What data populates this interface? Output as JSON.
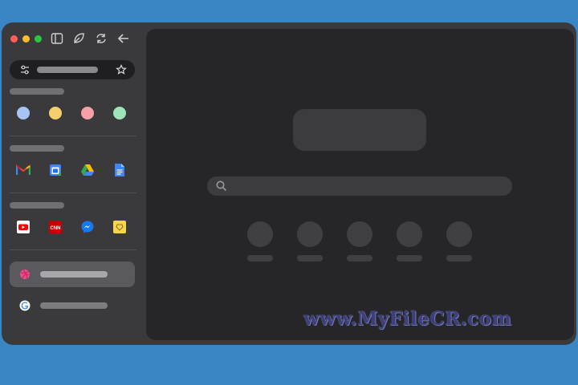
{
  "window": {
    "traffic_lights": [
      {
        "name": "close",
        "color": "#ff5f57"
      },
      {
        "name": "minimize",
        "color": "#febc2e"
      },
      {
        "name": "maximize",
        "color": "#28c840"
      }
    ],
    "toolbar_icons": [
      "sidebar-toggle-icon",
      "leaf-icon",
      "refresh-icon",
      "back-arrow-icon"
    ]
  },
  "sidebar": {
    "urlbar": {
      "left_icon": "sliders-icon",
      "right_icon": "star-icon"
    },
    "space_colors": [
      "#a8c4f5",
      "#f5cf6b",
      "#f5a1a8",
      "#9fe3b8"
    ],
    "pinned_row_1": [
      "gmail-icon",
      "google-calendar-icon",
      "google-drive-icon",
      "google-docs-icon"
    ],
    "pinned_row_2": [
      "youtube-icon",
      "cnn-icon",
      "messenger-icon",
      "notes-icon"
    ],
    "tabs": [
      {
        "icon": "dribbble-icon",
        "active": true
      },
      {
        "icon": "google-icon",
        "active": false
      }
    ]
  },
  "content": {
    "search_icon": "search-icon",
    "shortcut_count": 5
  },
  "watermark": {
    "text": "www.MyFileCR.com"
  }
}
